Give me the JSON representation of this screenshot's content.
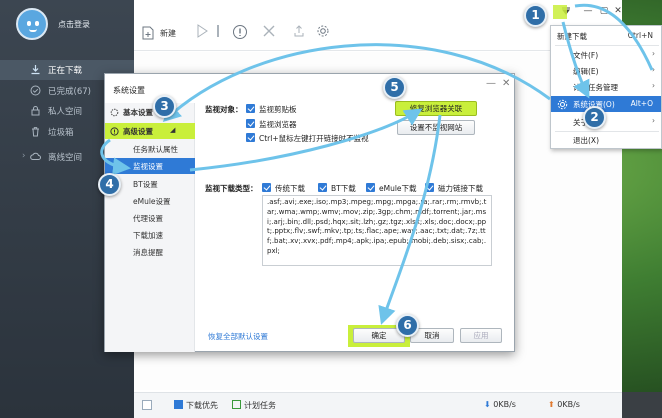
{
  "sidebar": {
    "login_label": "点击登录",
    "items": [
      {
        "label": "正在下载",
        "icon": "download-icon"
      },
      {
        "label": "已完成(67)",
        "icon": "check-circle-icon"
      },
      {
        "label": "私人空间",
        "icon": "lock-icon"
      },
      {
        "label": "垃圾箱",
        "icon": "trash-icon"
      },
      {
        "label": "离线空间",
        "icon": "cloud-icon"
      }
    ]
  },
  "toolbar": {
    "new_label": "新建"
  },
  "statusbar": {
    "download_priority": "下载优先",
    "scheduled_tasks": "计划任务",
    "down_speed": "0KB/s",
    "up_speed": "0KB/s"
  },
  "menu": {
    "items": [
      {
        "label": "新建下载",
        "shortcut": "Ctrl+N"
      },
      {
        "label": "文件(F)",
        "submenu": true
      },
      {
        "label": "编辑(E)",
        "submenu": true
      },
      {
        "label": "计划任务管理",
        "submenu": true
      },
      {
        "label": "系统设置(O)",
        "shortcut": "Alt+O",
        "selected": true
      },
      {
        "label": "关于",
        "submenu": true
      },
      {
        "label": "退出(X)"
      }
    ]
  },
  "dialog": {
    "title": "系统设置",
    "nav": [
      {
        "label": "基本设置",
        "type": "header"
      },
      {
        "label": "高级设置",
        "type": "header"
      },
      {
        "label": "任务默认属性",
        "type": "item"
      },
      {
        "label": "监视设置",
        "type": "item",
        "selected": true
      },
      {
        "label": "BT设置",
        "type": "item"
      },
      {
        "label": "eMule设置",
        "type": "item"
      },
      {
        "label": "代理设置",
        "type": "item"
      },
      {
        "label": "下载加速",
        "type": "item"
      },
      {
        "label": "消息提醒",
        "type": "item"
      }
    ],
    "monitor_object_label": "监视对象：",
    "monitor_options": [
      "监视剪贴板",
      "监视浏览器",
      "Ctrl+鼠标左键打开链接时不监视"
    ],
    "repair_browser_button": "修复浏览器关联",
    "exclude_sites_button": "设置不监视网站",
    "monitor_types_label": "监视下载类型：",
    "download_types": [
      "传统下载",
      "BT下载",
      "eMule下载",
      "磁力链接下载"
    ],
    "extensions": ".asf;.avi;.exe;.iso;.mp3;.mpeg;.mpg;.mpga;.ra;.rar;.rm;.rmvb;.tar;.wma;.wmp;.wmv;.mov;.zip;.3gp;.chm;.mdf;.torrent;.jar;.msi;.arj;.bin;.dll;.psd;.hqx;.sit;.lzh;.gz;.tgz;.xlsx;.xls;.doc;.docx;.ppt;.pptx;.flv;.swf;.mkv;.tp;.ts;.flac;.ape;.wav;.aac;.txt;.dat;.7z;.ttf;.bat;.xv;.xvx;.pdf;.mp4;.apk;.ipa;.epub;.mobi;.deb;.sisx;.cab;.pxl;",
    "restore_defaults_link": "恢复全部默认设置",
    "ok_button": "确定",
    "cancel_button": "取消",
    "apply_button": "应用"
  },
  "steps": [
    "1",
    "2",
    "3",
    "4",
    "5",
    "6"
  ],
  "colors": {
    "highlight": "#c9ef3b",
    "accent": "#2f7ad6",
    "badge": "#2f6ea8",
    "arrow": "#6ec3ea"
  }
}
